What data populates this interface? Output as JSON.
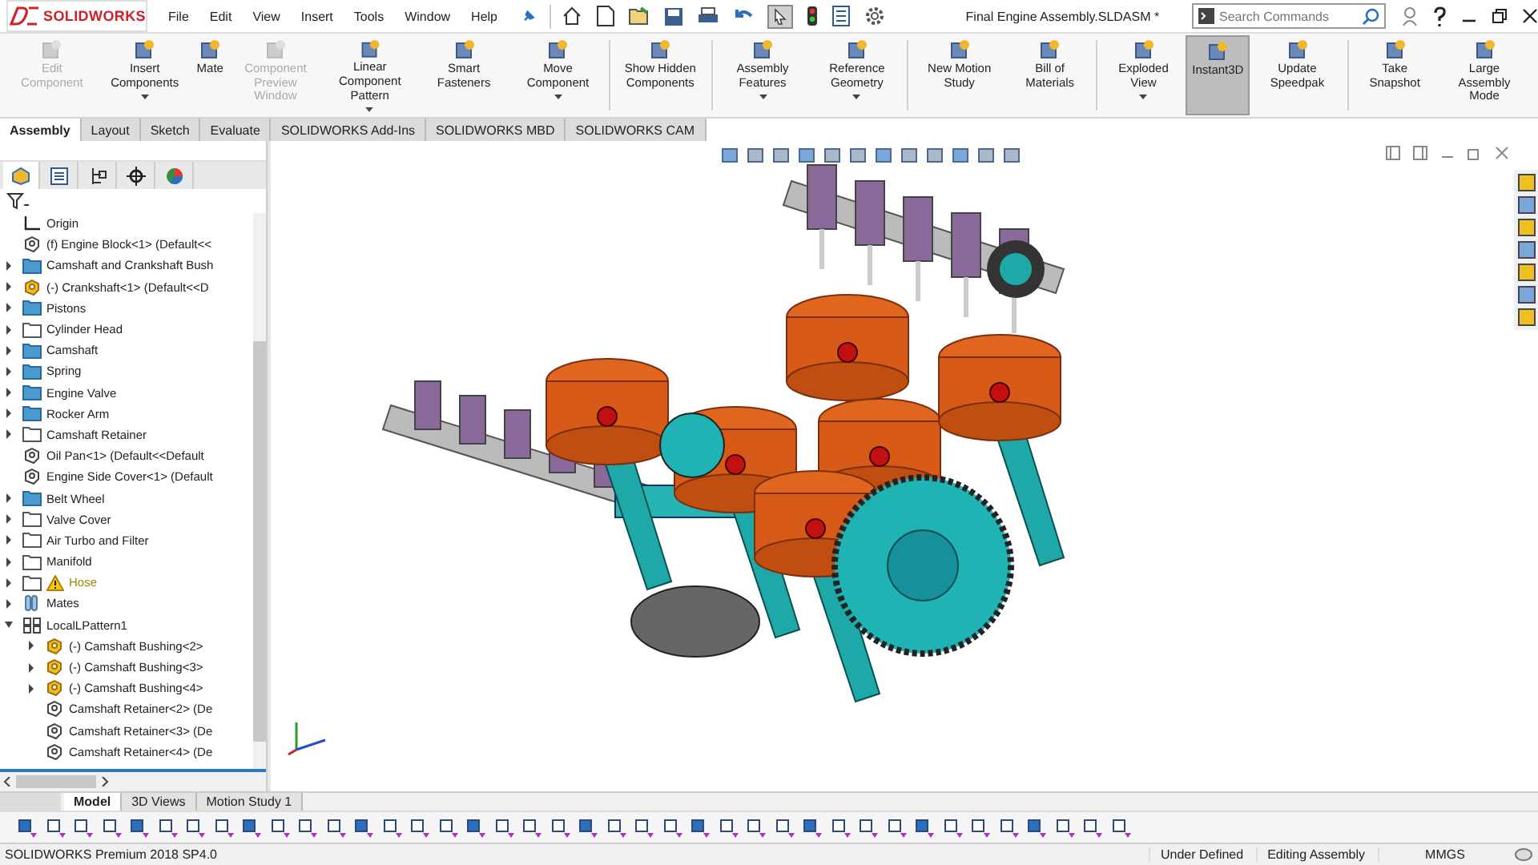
{
  "app": {
    "logo": "SOLIDWORKS",
    "menus": [
      "File",
      "Edit",
      "View",
      "Insert",
      "Tools",
      "Window",
      "Help"
    ],
    "title": "Final Engine Assembly.SLDASM *",
    "search": {
      "placeholder": "Search Commands"
    }
  },
  "ribbon": {
    "groups": [
      [
        {
          "label": "Edit Component",
          "disabled": true,
          "dropdown": false,
          "selected": false
        },
        {
          "label": "Insert Components",
          "disabled": false,
          "dropdown": true,
          "selected": false
        },
        {
          "label": "Mate",
          "disabled": false,
          "dropdown": false,
          "selected": false
        },
        {
          "label": "Component Preview Window",
          "disabled": true,
          "dropdown": false,
          "selected": false
        },
        {
          "label": "Linear Component Pattern",
          "disabled": false,
          "dropdown": true,
          "selected": false
        },
        {
          "label": "Smart Fasteners",
          "disabled": false,
          "dropdown": false,
          "selected": false
        },
        {
          "label": "Move Component",
          "disabled": false,
          "dropdown": true,
          "selected": false
        }
      ],
      [
        {
          "label": "Show Hidden Components",
          "disabled": false,
          "dropdown": false,
          "selected": false
        }
      ],
      [
        {
          "label": "Assembly Features",
          "disabled": false,
          "dropdown": true,
          "selected": false
        },
        {
          "label": "Reference Geometry",
          "disabled": false,
          "dropdown": true,
          "selected": false
        }
      ],
      [
        {
          "label": "New Motion Study",
          "disabled": false,
          "dropdown": false,
          "selected": false
        },
        {
          "label": "Bill of Materials",
          "disabled": false,
          "dropdown": false,
          "selected": false
        }
      ],
      [
        {
          "label": "Exploded View",
          "disabled": false,
          "dropdown": true,
          "selected": false
        },
        {
          "label": "Instant3D",
          "disabled": false,
          "dropdown": false,
          "selected": true
        },
        {
          "label": "Update Speedpak",
          "disabled": false,
          "dropdown": false,
          "selected": false
        }
      ],
      [
        {
          "label": "Take Snapshot",
          "disabled": false,
          "dropdown": false,
          "selected": false
        },
        {
          "label": "Large Assembly Mode",
          "disabled": false,
          "dropdown": false,
          "selected": false
        }
      ]
    ]
  },
  "command_tabs": [
    {
      "label": "Assembly",
      "selected": true
    },
    {
      "label": "Layout",
      "selected": false
    },
    {
      "label": "Sketch",
      "selected": false
    },
    {
      "label": "Evaluate",
      "selected": false
    },
    {
      "label": "SOLIDWORKS Add-Ins",
      "selected": false
    },
    {
      "label": "SOLIDWORKS MBD",
      "selected": false
    },
    {
      "label": "SOLIDWORKS CAM",
      "selected": false
    }
  ],
  "feature_tree": {
    "items": [
      {
        "label": "Origin",
        "kind": "origin"
      },
      {
        "label": "(f) Engine Block<1> (Default<<",
        "kind": "component"
      },
      {
        "label": "Camshaft and Crankshaft Bush",
        "kind": "folder",
        "expanded": false
      },
      {
        "label": "(-) Crankshaft<1> (Default<<D",
        "kind": "component-underdefined",
        "expanded": false
      },
      {
        "label": "Pistons",
        "kind": "folder",
        "expanded": false
      },
      {
        "label": "Cylinder Head",
        "kind": "empty-folder",
        "expanded": false
      },
      {
        "label": "Camshaft",
        "kind": "folder",
        "expanded": false
      },
      {
        "label": "Spring",
        "kind": "folder",
        "expanded": false
      },
      {
        "label": "Engine Valve",
        "kind": "folder",
        "expanded": false
      },
      {
        "label": "Rocker Arm",
        "kind": "folder",
        "expanded": false
      },
      {
        "label": "Camshaft Retainer",
        "kind": "empty-folder",
        "expanded": false
      },
      {
        "label": "Oil Pan<1> (Default<<Default",
        "kind": "component"
      },
      {
        "label": "Engine Side Cover<1> (Default",
        "kind": "component"
      },
      {
        "label": "Belt Wheel",
        "kind": "folder",
        "expanded": false
      },
      {
        "label": "Valve Cover",
        "kind": "empty-folder",
        "expanded": false
      },
      {
        "label": "Air Turbo and Filter",
        "kind": "empty-folder",
        "expanded": false
      },
      {
        "label": "Manifold",
        "kind": "empty-folder",
        "expanded": false
      },
      {
        "label": "Hose",
        "kind": "empty-folder",
        "expanded": false,
        "warning": true
      },
      {
        "label": "Mates",
        "kind": "mates",
        "expanded": false
      },
      {
        "label": "LocalLPattern1",
        "kind": "pattern",
        "expanded": true,
        "children": [
          {
            "label": "(-) Camshaft Bushing<2>",
            "kind": "component-underdefined",
            "expanded": false
          },
          {
            "label": "(-) Camshaft Bushing<3>",
            "kind": "component-underdefined",
            "expanded": false
          },
          {
            "label": "(-) Camshaft Bushing<4>",
            "kind": "component-underdefined",
            "expanded": false
          },
          {
            "label": "Camshaft Retainer<2> (De",
            "kind": "component"
          },
          {
            "label": "Camshaft Retainer<3> (De",
            "kind": "component"
          },
          {
            "label": "Camshaft Retainer<4> (De",
            "kind": "component"
          }
        ]
      }
    ]
  },
  "bottom_tabs": [
    {
      "label": "Model",
      "selected": true
    },
    {
      "label": "3D Views",
      "selected": false
    },
    {
      "label": "Motion Study 1",
      "selected": false
    }
  ],
  "status_bar": {
    "product": "SOLIDWORKS Premium 2018 SP4.0",
    "state": "Under Defined",
    "mode": "Editing Assembly",
    "units": "MMGS"
  }
}
